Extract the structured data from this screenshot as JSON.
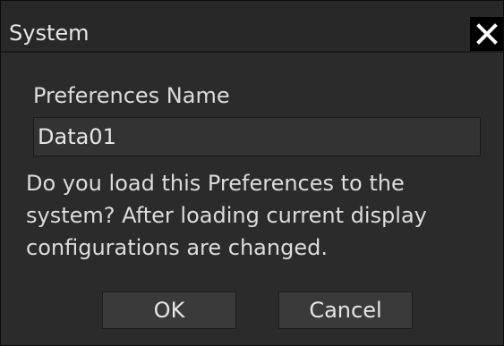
{
  "dialog": {
    "title": "System",
    "close_icon": "close-icon"
  },
  "form": {
    "label": "Preferences Name",
    "value": "Data01"
  },
  "message": {
    "lines": [
      "Do you load this Preferences to the",
      "system? After loading current display",
      "configurations are changed."
    ]
  },
  "buttons": {
    "ok_label": "OK",
    "cancel_label": "Cancel"
  },
  "colors": {
    "background": "#2b2b2b",
    "titlebar": "#282828",
    "text": "#dcdcdc",
    "button": "#3a3a3a",
    "close_button": "#000000"
  }
}
